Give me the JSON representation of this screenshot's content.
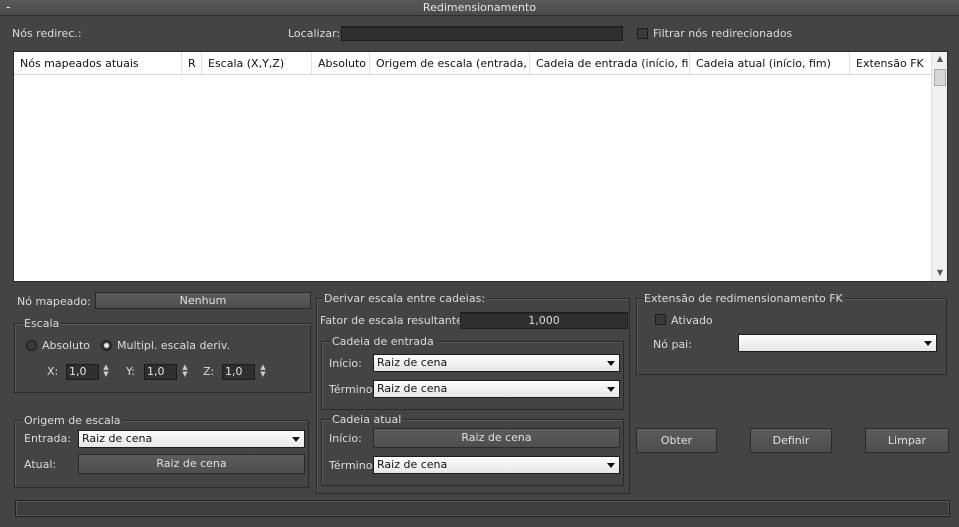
{
  "title": "Redimensionamento",
  "collapse_glyph": "-",
  "top": {
    "redirected_label": "Nós redirec.:",
    "find_label": "Localizar:",
    "find_value": "",
    "filter_label": "Filtrar nós redirecionados"
  },
  "table": {
    "columns": [
      "Nós mapeados atuais",
      "R",
      "Escala (X,Y,Z)",
      "Absoluto",
      "Origem de escala (entrada, ...",
      "Cadeia de entrada (início, fim)",
      "Cadeia atual (início, fim)",
      "Extensão FK"
    ],
    "rows": []
  },
  "mapped_node": {
    "label": "Nó mapeado:",
    "value": "Nenhum"
  },
  "scale_group": {
    "title": "Escala",
    "absolute_label": "Absoluto",
    "mult_label": "Multipl. escala deriv.",
    "x_label": "X:",
    "x_value": "1,0",
    "y_label": "Y:",
    "y_value": "1,0",
    "z_label": "Z:",
    "z_value": "1,0"
  },
  "scale_origin": {
    "title": "Origem de escala",
    "input_label": "Entrada:",
    "input_value": "Raiz de cena",
    "current_label": "Atual:",
    "current_value": "Raiz de cena"
  },
  "derive": {
    "title": "Derivar escala entre cadeias:",
    "factor_label": "Fator de escala resultante:",
    "factor_value": "1,000",
    "input_chain": {
      "title": "Cadeia de entrada",
      "start_label": "Início:",
      "start_value": "Raiz de cena",
      "end_label": "Término:",
      "end_value": "Raiz de cena"
    },
    "current_chain": {
      "title": "Cadeia atual",
      "start_label": "Início:",
      "start_value": "Raiz de cena",
      "end_label": "Término:",
      "end_value": "Raiz de cena"
    }
  },
  "fk": {
    "title": "Extensão de redimensionamento FK",
    "enabled_label": "Ativado",
    "parent_label": "Nó pai:",
    "parent_value": ""
  },
  "buttons": {
    "get": "Obter",
    "set": "Definir",
    "clear": "Limpar"
  },
  "status_text": ""
}
